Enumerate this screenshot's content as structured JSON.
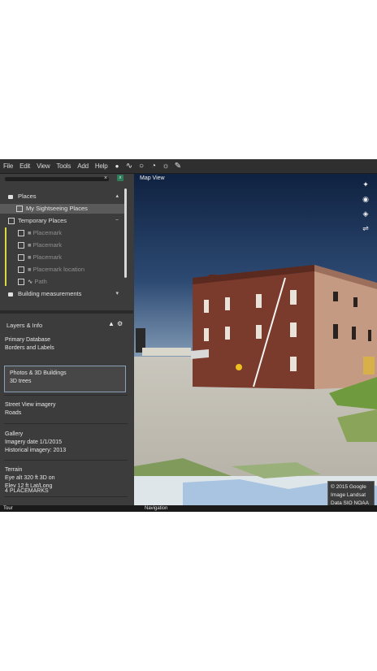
{
  "toolbar": {
    "menus": [
      "File",
      "Edit",
      "View",
      "Tools",
      "Add",
      "Help"
    ],
    "tools": [
      "placemark-icon",
      "path-icon",
      "polygon-icon",
      "history-icon",
      "sun-icon",
      "sky-icon"
    ]
  },
  "view": {
    "label": "Map View"
  },
  "sidebar": {
    "search_clear": "×",
    "places": {
      "items": [
        {
          "label": "Places",
          "kind": "folder",
          "expanded": true
        },
        {
          "label": "My Sightseeing Places",
          "kind": "checkbox",
          "selected": true
        },
        {
          "label": "Temporary Places",
          "kind": "folder",
          "expanded": true
        },
        {
          "label": "Placemark",
          "kind": "sub"
        },
        {
          "label": "Placemark",
          "kind": "sub"
        },
        {
          "label": "Placemark",
          "kind": "sub"
        },
        {
          "label": "Placemark location",
          "kind": "sub"
        },
        {
          "label": "Path",
          "kind": "sub"
        },
        {
          "label": "Building measurements",
          "kind": "folder",
          "expanded": false
        }
      ]
    },
    "layers": {
      "title": "Layers & Info",
      "subtitle": "Primary Database",
      "sub2": "Borders and Labels",
      "highlight_line1": "Photos & 3D Buildings",
      "highlight_line2": "3D trees",
      "block1_line1": "Street View imagery",
      "block1_line2": "Roads",
      "block2_title": "Gallery",
      "block2_line1": "Imagery date  1/1/2015",
      "block2_line2": "Historical imagery: 2013",
      "block3_title": "Terrain",
      "block3_line1": "Eye alt  320 ft  3D on",
      "block3_line2": "Elev  12 ft  Lat/Long",
      "status": "4 PLACEMARKS"
    }
  },
  "scale": {
    "line1": "© 2015 Google",
    "line2": "Image Landsat",
    "line3": "Data SIO NOAA"
  },
  "bottom": {
    "left": "Tour",
    "right": "Navigation"
  }
}
